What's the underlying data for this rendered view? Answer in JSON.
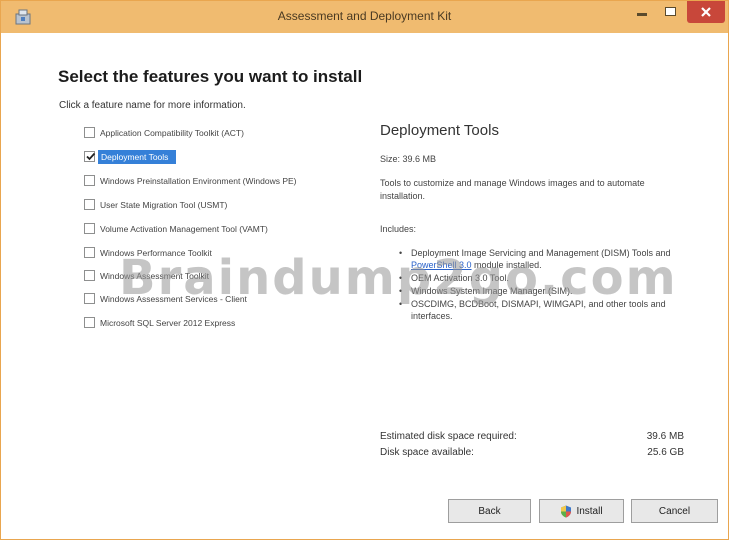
{
  "window": {
    "title": "Assessment and Deployment Kit",
    "accent_color": "#f0bb70",
    "close_color": "#c8473a"
  },
  "page": {
    "heading": "Select the features you want to install",
    "subheading": "Click a feature name for more information."
  },
  "features": [
    {
      "label": "Application Compatibility Toolkit (ACT)",
      "checked": false
    },
    {
      "label": "Deployment Tools",
      "checked": true
    },
    {
      "label": "Windows Preinstallation Environment (Windows PE)",
      "checked": false
    },
    {
      "label": "User State Migration Tool (USMT)",
      "checked": false
    },
    {
      "label": "Volume Activation Management Tool (VAMT)",
      "checked": false
    },
    {
      "label": "Windows Performance Toolkit",
      "checked": false
    },
    {
      "label": "Windows Assessment Toolkit",
      "checked": false
    },
    {
      "label": "Windows Assessment Services - Client",
      "checked": false
    },
    {
      "label": "Microsoft SQL Server 2012 Express",
      "checked": false
    }
  ],
  "details": {
    "title": "Deployment Tools",
    "size": "Size: 39.6 MB",
    "description": "Tools to customize and manage Windows images and to automate installation.",
    "includes_label": "Includes:",
    "includes": [
      {
        "text": "Deployment Image Servicing and Management (DISM) Tools and",
        "link": "PowerShell 3.0",
        "after": " module installed."
      },
      {
        "text": "OEM Activation 3.0 Tool."
      },
      {
        "text": "Windows System Image Manager (SIM)."
      },
      {
        "text": "OSCDIMG, BCDBoot, DISMAPI, WIMGAPI, and other tools and interfaces."
      }
    ]
  },
  "disk": {
    "required_label": "Estimated disk space required:",
    "required_value": "39.6 MB",
    "available_label": "Disk space available:",
    "available_value": "25.6 GB"
  },
  "buttons": {
    "back": "Back",
    "install": "Install",
    "cancel": "Cancel"
  },
  "watermark": "Braindump2go.com",
  "icons": {
    "app": "installer-icon",
    "install": "uac-shield-icon"
  }
}
